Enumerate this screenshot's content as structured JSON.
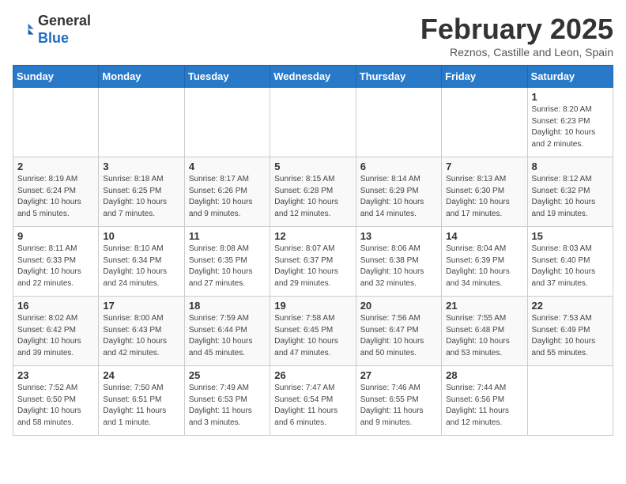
{
  "header": {
    "logo_general": "General",
    "logo_blue": "Blue",
    "month_title": "February 2025",
    "subtitle": "Reznos, Castille and Leon, Spain"
  },
  "weekdays": [
    "Sunday",
    "Monday",
    "Tuesday",
    "Wednesday",
    "Thursday",
    "Friday",
    "Saturday"
  ],
  "weeks": [
    [
      {
        "day": "",
        "info": ""
      },
      {
        "day": "",
        "info": ""
      },
      {
        "day": "",
        "info": ""
      },
      {
        "day": "",
        "info": ""
      },
      {
        "day": "",
        "info": ""
      },
      {
        "day": "",
        "info": ""
      },
      {
        "day": "1",
        "info": "Sunrise: 8:20 AM\nSunset: 6:23 PM\nDaylight: 10 hours\nand 2 minutes."
      }
    ],
    [
      {
        "day": "2",
        "info": "Sunrise: 8:19 AM\nSunset: 6:24 PM\nDaylight: 10 hours\nand 5 minutes."
      },
      {
        "day": "3",
        "info": "Sunrise: 8:18 AM\nSunset: 6:25 PM\nDaylight: 10 hours\nand 7 minutes."
      },
      {
        "day": "4",
        "info": "Sunrise: 8:17 AM\nSunset: 6:26 PM\nDaylight: 10 hours\nand 9 minutes."
      },
      {
        "day": "5",
        "info": "Sunrise: 8:15 AM\nSunset: 6:28 PM\nDaylight: 10 hours\nand 12 minutes."
      },
      {
        "day": "6",
        "info": "Sunrise: 8:14 AM\nSunset: 6:29 PM\nDaylight: 10 hours\nand 14 minutes."
      },
      {
        "day": "7",
        "info": "Sunrise: 8:13 AM\nSunset: 6:30 PM\nDaylight: 10 hours\nand 17 minutes."
      },
      {
        "day": "8",
        "info": "Sunrise: 8:12 AM\nSunset: 6:32 PM\nDaylight: 10 hours\nand 19 minutes."
      }
    ],
    [
      {
        "day": "9",
        "info": "Sunrise: 8:11 AM\nSunset: 6:33 PM\nDaylight: 10 hours\nand 22 minutes."
      },
      {
        "day": "10",
        "info": "Sunrise: 8:10 AM\nSunset: 6:34 PM\nDaylight: 10 hours\nand 24 minutes."
      },
      {
        "day": "11",
        "info": "Sunrise: 8:08 AM\nSunset: 6:35 PM\nDaylight: 10 hours\nand 27 minutes."
      },
      {
        "day": "12",
        "info": "Sunrise: 8:07 AM\nSunset: 6:37 PM\nDaylight: 10 hours\nand 29 minutes."
      },
      {
        "day": "13",
        "info": "Sunrise: 8:06 AM\nSunset: 6:38 PM\nDaylight: 10 hours\nand 32 minutes."
      },
      {
        "day": "14",
        "info": "Sunrise: 8:04 AM\nSunset: 6:39 PM\nDaylight: 10 hours\nand 34 minutes."
      },
      {
        "day": "15",
        "info": "Sunrise: 8:03 AM\nSunset: 6:40 PM\nDaylight: 10 hours\nand 37 minutes."
      }
    ],
    [
      {
        "day": "16",
        "info": "Sunrise: 8:02 AM\nSunset: 6:42 PM\nDaylight: 10 hours\nand 39 minutes."
      },
      {
        "day": "17",
        "info": "Sunrise: 8:00 AM\nSunset: 6:43 PM\nDaylight: 10 hours\nand 42 minutes."
      },
      {
        "day": "18",
        "info": "Sunrise: 7:59 AM\nSunset: 6:44 PM\nDaylight: 10 hours\nand 45 minutes."
      },
      {
        "day": "19",
        "info": "Sunrise: 7:58 AM\nSunset: 6:45 PM\nDaylight: 10 hours\nand 47 minutes."
      },
      {
        "day": "20",
        "info": "Sunrise: 7:56 AM\nSunset: 6:47 PM\nDaylight: 10 hours\nand 50 minutes."
      },
      {
        "day": "21",
        "info": "Sunrise: 7:55 AM\nSunset: 6:48 PM\nDaylight: 10 hours\nand 53 minutes."
      },
      {
        "day": "22",
        "info": "Sunrise: 7:53 AM\nSunset: 6:49 PM\nDaylight: 10 hours\nand 55 minutes."
      }
    ],
    [
      {
        "day": "23",
        "info": "Sunrise: 7:52 AM\nSunset: 6:50 PM\nDaylight: 10 hours\nand 58 minutes."
      },
      {
        "day": "24",
        "info": "Sunrise: 7:50 AM\nSunset: 6:51 PM\nDaylight: 11 hours\nand 1 minute."
      },
      {
        "day": "25",
        "info": "Sunrise: 7:49 AM\nSunset: 6:53 PM\nDaylight: 11 hours\nand 3 minutes."
      },
      {
        "day": "26",
        "info": "Sunrise: 7:47 AM\nSunset: 6:54 PM\nDaylight: 11 hours\nand 6 minutes."
      },
      {
        "day": "27",
        "info": "Sunrise: 7:46 AM\nSunset: 6:55 PM\nDaylight: 11 hours\nand 9 minutes."
      },
      {
        "day": "28",
        "info": "Sunrise: 7:44 AM\nSunset: 6:56 PM\nDaylight: 11 hours\nand 12 minutes."
      },
      {
        "day": "",
        "info": ""
      }
    ]
  ]
}
